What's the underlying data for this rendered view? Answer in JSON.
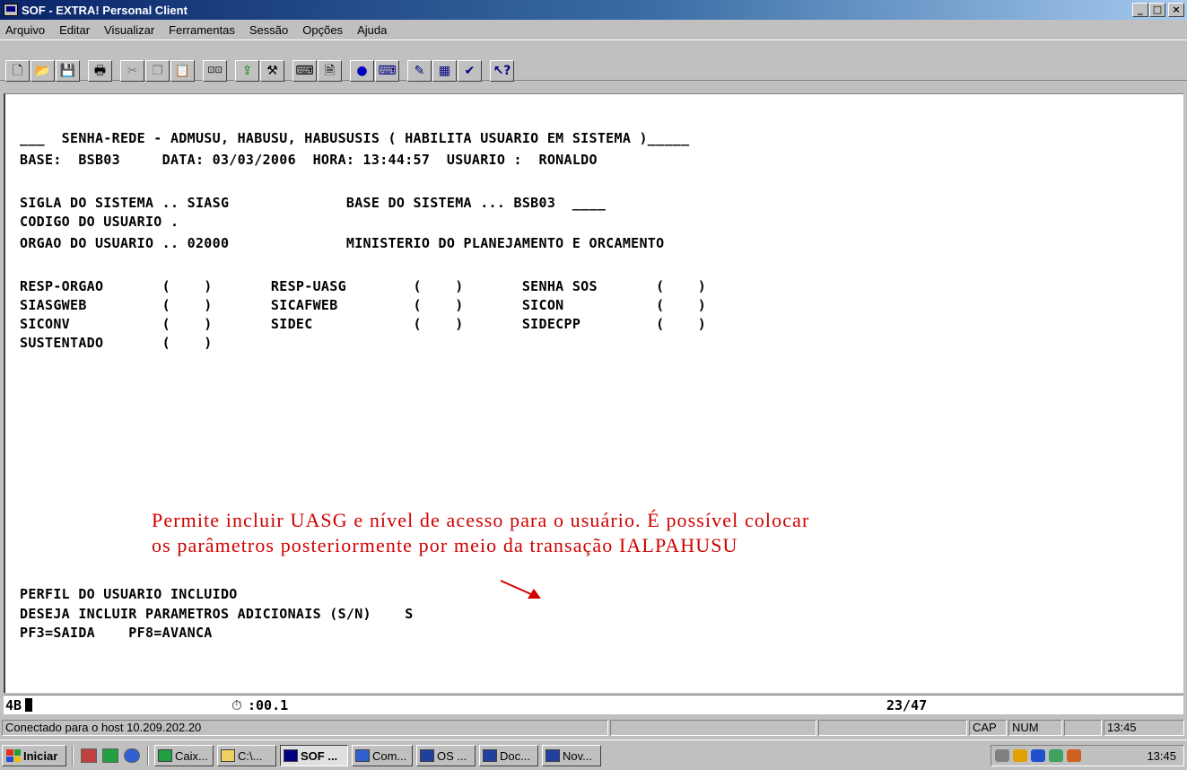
{
  "window": {
    "title": "SOF - EXTRA! Personal Client",
    "minimize": "_",
    "maximize": "□",
    "close": "×"
  },
  "menu": [
    "Arquivo",
    "Editar",
    "Visualizar",
    "Ferramentas",
    "Sessão",
    "Opções",
    "Ajuda"
  ],
  "toolbar_icons": [
    "new-icon",
    "open-icon",
    "save-icon",
    "print-icon",
    "cut-icon",
    "copy-icon",
    "paste-icon",
    "display-icon",
    "transfer-icon",
    "tools-icon",
    "macro-icon",
    "send-icon",
    "receive-icon",
    "record-icon",
    "keyboard-icon",
    "edit-macro-icon",
    "options-icon",
    "settings-icon",
    "help-icon"
  ],
  "terminal": {
    "lines": [
      "___  SENHA-REDE - ADMUSU, HABUSU, HABUSUSIS ( HABILITA USUARIO EM SISTEMA )_____",
      "BASE:  BSB03     DATA: 03/03/2006  HORA: 13:44:57  USUARIO :  RONALDO",
      "SIGLA DO SISTEMA .. SIASG              BASE DO SISTEMA ... BSB03  ____",
      "CODIGO DO USUARIO .",
      "ORGAO DO USUARIO .. 02000              MINISTERIO DO PLANEJAMENTO E ORCAMENTO",
      "RESP-ORGAO       (    )       RESP-UASG        (    )       SENHA SOS       (    )",
      "SIASGWEB         (    )       SICAFWEB         (    )       SICON           (    )",
      "SICONV           (    )       SIDEC            (    )       SIDECPP         (    )",
      "SUSTENTADO       (    )",
      "PERFIL DO USUARIO INCLUIDO",
      "DESEJA INCLUIR PARAMETROS ADICIONAIS (S/N)    S",
      "PF3=SAIDA    PF8=AVANCA"
    ],
    "annotation_1": "Permite incluir UASG e nível de acesso para o usuário. É possível colocar",
    "annotation_2": "os parâmetros posteriormente por meio da transação IALPAHUSU",
    "annotation_color": "#d00000"
  },
  "oia": {
    "mode": "4B",
    "timer": ":00.1",
    "cursor_pos": "23/47"
  },
  "statusbar": {
    "connection": "Conectado para o host 10.209.202.20",
    "caps": "CAP",
    "num": "NUM",
    "time": "13:45"
  },
  "taskbar": {
    "start": "Iniciar",
    "tasks": [
      "Caix...",
      "C:\\...",
      "SOF ...",
      "Com...",
      "OS ...",
      "Doc...",
      "Nov..."
    ],
    "clock": "13:45"
  }
}
